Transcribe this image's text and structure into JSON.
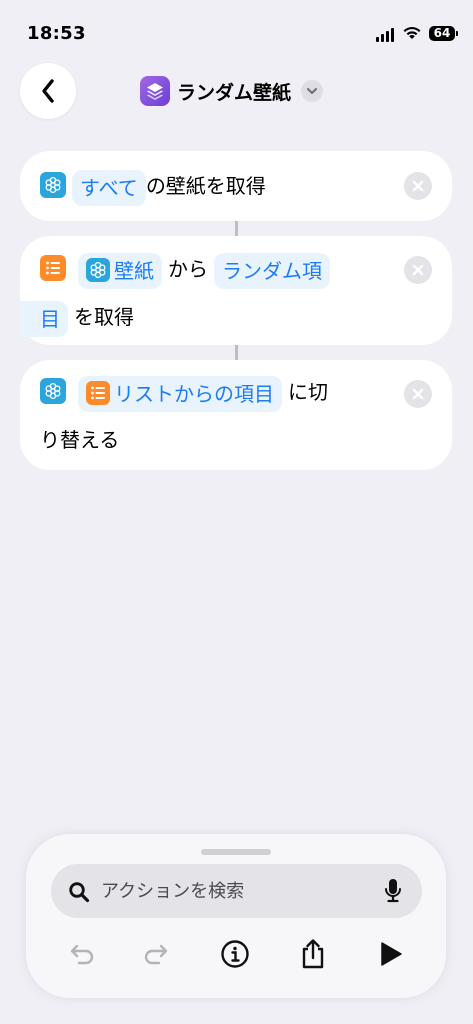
{
  "status_bar": {
    "time": "18:53",
    "battery": "64"
  },
  "header": {
    "title": "ランダム壁紙"
  },
  "actions": [
    {
      "token": "すべて",
      "text": "の壁紙を取得"
    },
    {
      "var_label": "壁紙",
      "connector": "から",
      "token_part1": "ランダム項",
      "token_part2": "目",
      "text": "を取得"
    },
    {
      "var_label": "リストからの項目",
      "text_part1": "に切",
      "text_part2": "り替える"
    }
  ],
  "search": {
    "placeholder": "アクションを検索"
  },
  "icons": {
    "back": "chevron-left-icon",
    "app": "shortcuts-stack-icon",
    "wallpaper": "flower-icon",
    "list": "list-icon",
    "remove": "close-icon",
    "search": "magnifier-icon",
    "mic": "microphone-icon",
    "undo": "undo-icon",
    "redo": "redo-icon",
    "info": "info-icon",
    "share": "share-icon",
    "run": "play-icon"
  },
  "colors": {
    "background": "#f0eff5",
    "accent": "#1b7cf4",
    "wallpaper_icon": "#2aa6dd",
    "list_icon": "#fe8a2a",
    "app_icon": "#7b4fe0"
  }
}
